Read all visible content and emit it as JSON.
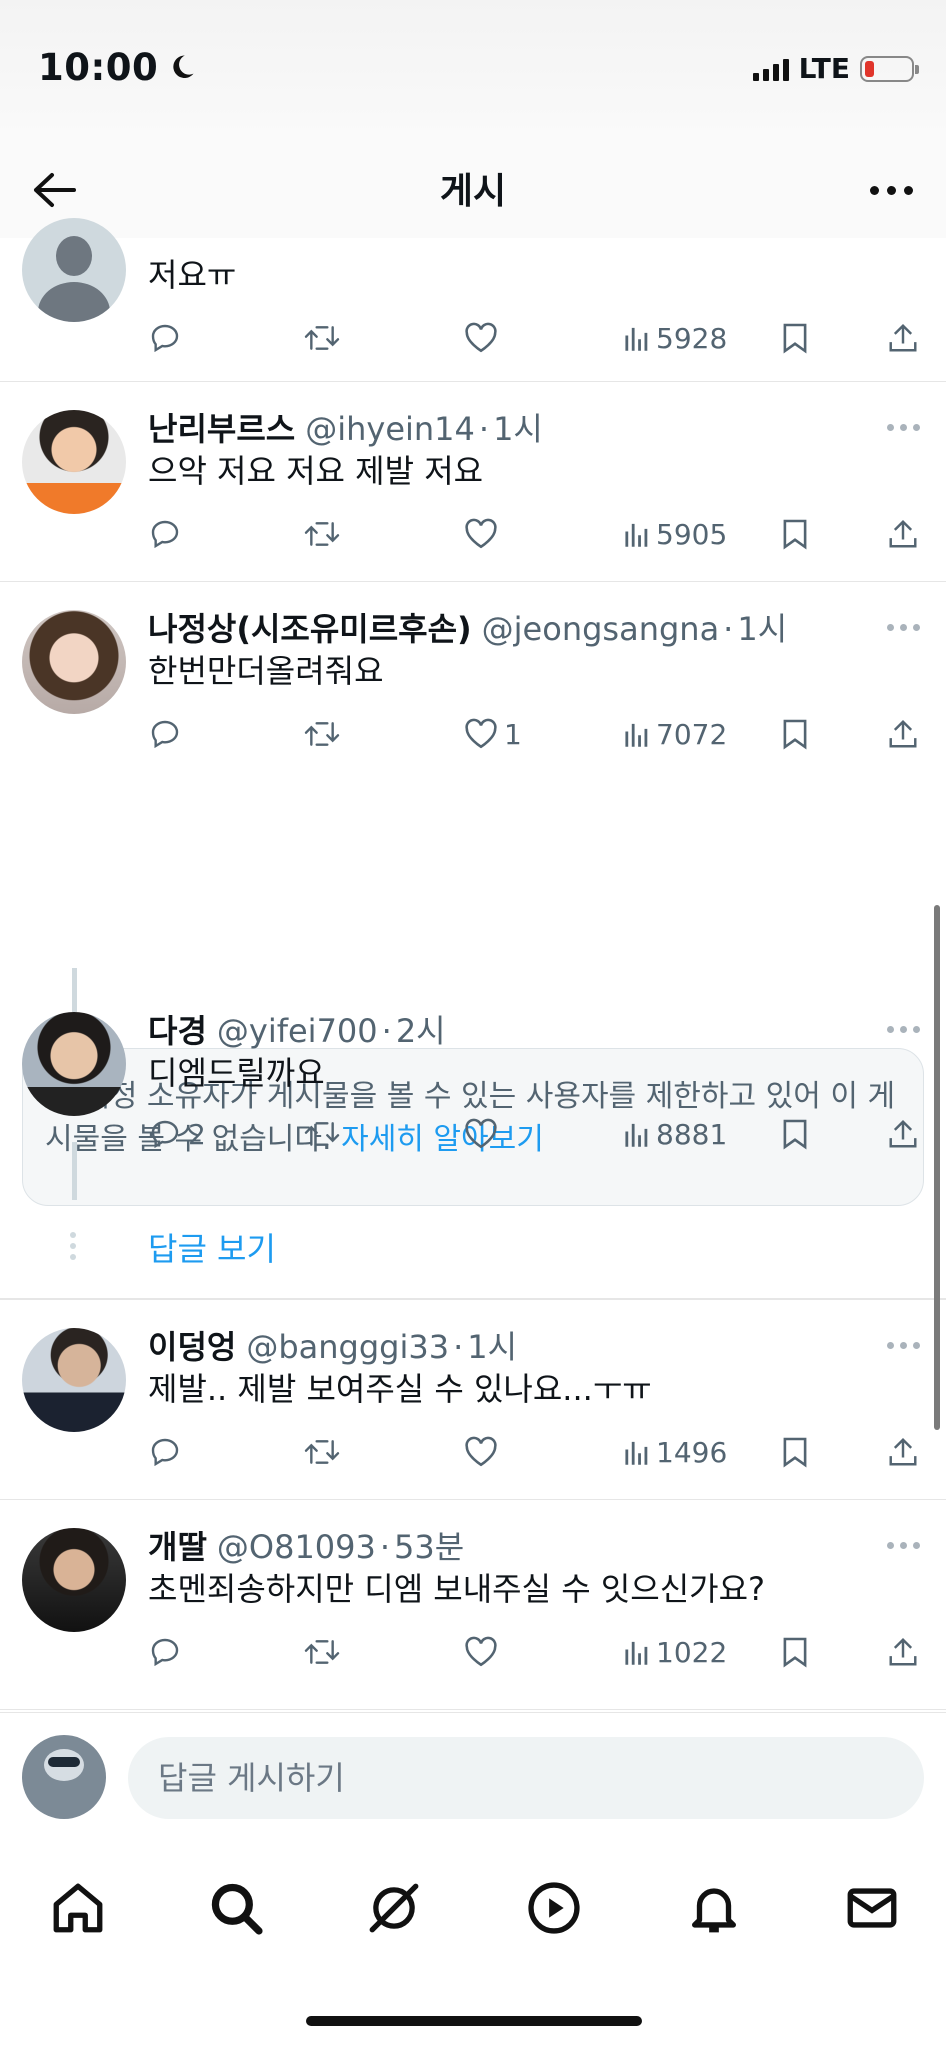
{
  "status_bar": {
    "time": "10:00",
    "network": "LTE"
  },
  "header": {
    "title": "게시"
  },
  "replies": [
    {
      "display_name": "",
      "handle": "",
      "time": "",
      "text": "저요ㅠ",
      "stats": {
        "replies": "",
        "reposts": "",
        "likes": "",
        "views": "5928"
      }
    },
    {
      "display_name": "난리부르스",
      "handle": "@ihyein14",
      "time": "1시",
      "text": "으악 저요 저요 제발 저요",
      "stats": {
        "replies": "",
        "reposts": "",
        "likes": "",
        "views": "5905"
      }
    },
    {
      "display_name": "나정상(시조유미르후손)",
      "handle": "@jeongsangna",
      "time": "1시",
      "text": "한번만더올려줘요",
      "stats": {
        "replies": "",
        "reposts": "",
        "likes": "1",
        "views": "7072"
      }
    },
    {
      "display_name": "다경",
      "handle": "@yifei700",
      "time": "2시",
      "text": "디엠드릴까요",
      "stats": {
        "replies": "2",
        "reposts": "",
        "likes": "",
        "views": "8881"
      }
    },
    {
      "display_name": "이덩엉",
      "handle": "@bangggi33",
      "time": "1시",
      "text": "제발.. 제발 보여주실 수 있나요...ㅜㅠ",
      "stats": {
        "replies": "",
        "reposts": "",
        "likes": "",
        "views": "1496"
      }
    },
    {
      "display_name": "개딸",
      "handle": "@O81093",
      "time": "53분",
      "text": "초멘죄송하지만 디엠 보내주실 수 잇으신가요?",
      "stats": {
        "replies": "",
        "reposts": "",
        "likes": "",
        "views": "1022"
      }
    }
  ],
  "notice": {
    "text": "이 계정 소유자가 게시물을 볼 수 있는 사용자를 제한하고 있어 이 게시물을 볼 수 없습니다.",
    "link": "자세히 알아보기"
  },
  "show_replies": "답글 보기",
  "compose": {
    "placeholder": "답글 게시하기"
  },
  "tabs": [
    "home-icon",
    "search-icon",
    "grok-icon",
    "video-icon",
    "bell-icon",
    "mail-icon"
  ],
  "colors": {
    "accent": "#1d9bf0",
    "text": "#0f1419",
    "muted": "#536471",
    "battery_low": "#e0352b"
  }
}
